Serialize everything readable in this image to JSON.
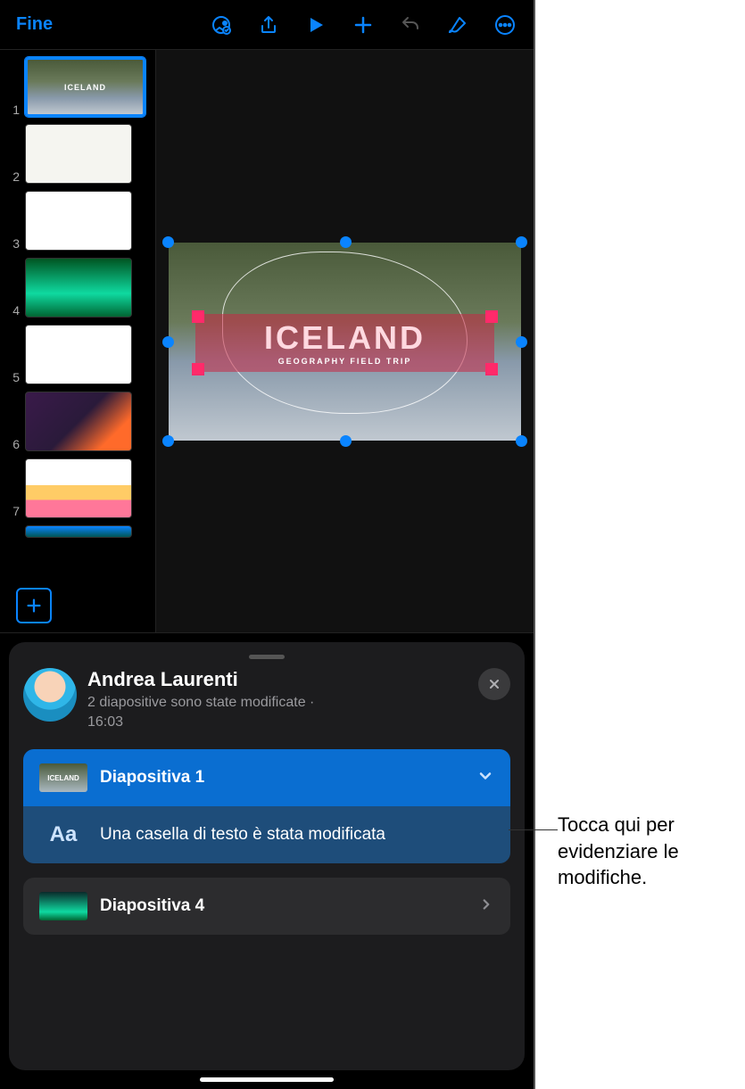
{
  "toolbar": {
    "done_label": "Fine"
  },
  "slide_canvas": {
    "title": "ICELAND",
    "subtitle": "GEOGRAPHY FIELD TRIP"
  },
  "sidebar": {
    "thumbs": [
      {
        "num": "1",
        "label": "ICELAND"
      },
      {
        "num": "2"
      },
      {
        "num": "3"
      },
      {
        "num": "4"
      },
      {
        "num": "5"
      },
      {
        "num": "6"
      },
      {
        "num": "7"
      }
    ]
  },
  "activity": {
    "user_name": "Andrea Laurenti",
    "summary": "2 diapositive sono state modificate",
    "separator": "·",
    "time": "16:03",
    "items": [
      {
        "title": "Diapositiva 1",
        "detail": "Una casella di testo è stata modificata",
        "expanded": true
      },
      {
        "title": "Diapositiva 4",
        "expanded": false
      }
    ],
    "detail_icon_text": "Aa"
  },
  "annotation": {
    "text": "Tocca qui per evidenziare le modifiche."
  }
}
